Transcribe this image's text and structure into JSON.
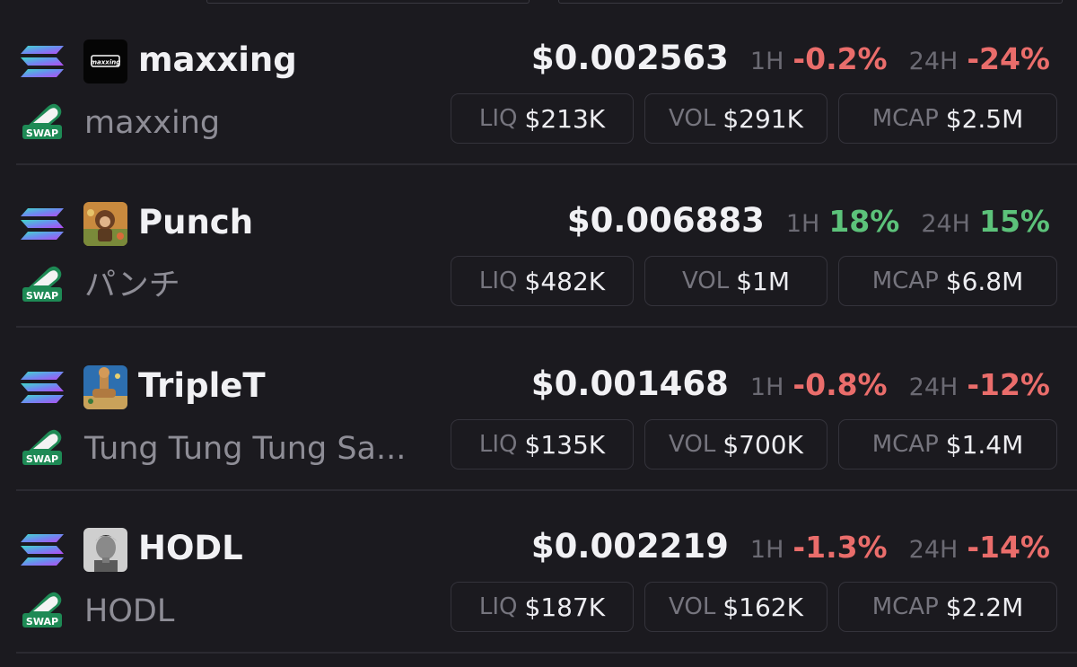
{
  "tokens": [
    {
      "symbol": "maxxing",
      "name": "maxxing",
      "price": "$0.002563",
      "h1_label": "1H",
      "h1_change": "-0.2%",
      "h1_dir": "neg",
      "h24_label": "24H",
      "h24_change": "-24%",
      "h24_dir": "neg",
      "liq_label": "LIQ",
      "liq": "$213K",
      "vol_label": "VOL",
      "vol": "$291K",
      "mcap_label": "MCAP",
      "mcap": "$2.5M",
      "avatar_text": "maxxing"
    },
    {
      "symbol": "Punch",
      "name": "パンチ",
      "price": "$0.006883",
      "h1_label": "1H",
      "h1_change": "18%",
      "h1_dir": "pos",
      "h24_label": "24H",
      "h24_change": "15%",
      "h24_dir": "pos",
      "liq_label": "LIQ",
      "liq": "$482K",
      "vol_label": "VOL",
      "vol": "$1M",
      "mcap_label": "MCAP",
      "mcap": "$6.8M"
    },
    {
      "symbol": "TripleT",
      "name": "Tung Tung Tung Sa...",
      "price": "$0.001468",
      "h1_label": "1H",
      "h1_change": "-0.8%",
      "h1_dir": "neg",
      "h24_label": "24H",
      "h24_change": "-12%",
      "h24_dir": "neg",
      "liq_label": "LIQ",
      "liq": "$135K",
      "vol_label": "VOL",
      "vol": "$700K",
      "mcap_label": "MCAP",
      "mcap": "$1.4M"
    },
    {
      "symbol": "HODL",
      "name": "HODL",
      "price": "$0.002219",
      "h1_label": "1H",
      "h1_change": "-1.3%",
      "h1_dir": "neg",
      "h24_label": "24H",
      "h24_change": "-14%",
      "h24_dir": "neg",
      "liq_label": "LIQ",
      "liq": "$187K",
      "vol_label": "VOL",
      "vol": "$162K",
      "mcap_label": "MCAP",
      "mcap": "$2.2M"
    }
  ],
  "icons": {
    "chain": "solana-icon",
    "dex": "swap-dex-icon",
    "dex_label": "SWAP"
  },
  "colors": {
    "background": "#1b1a1f",
    "negative": "#ea6d6b",
    "positive": "#5cc27a",
    "muted": "#6b6a73",
    "dex_green": "#1e8a55"
  }
}
